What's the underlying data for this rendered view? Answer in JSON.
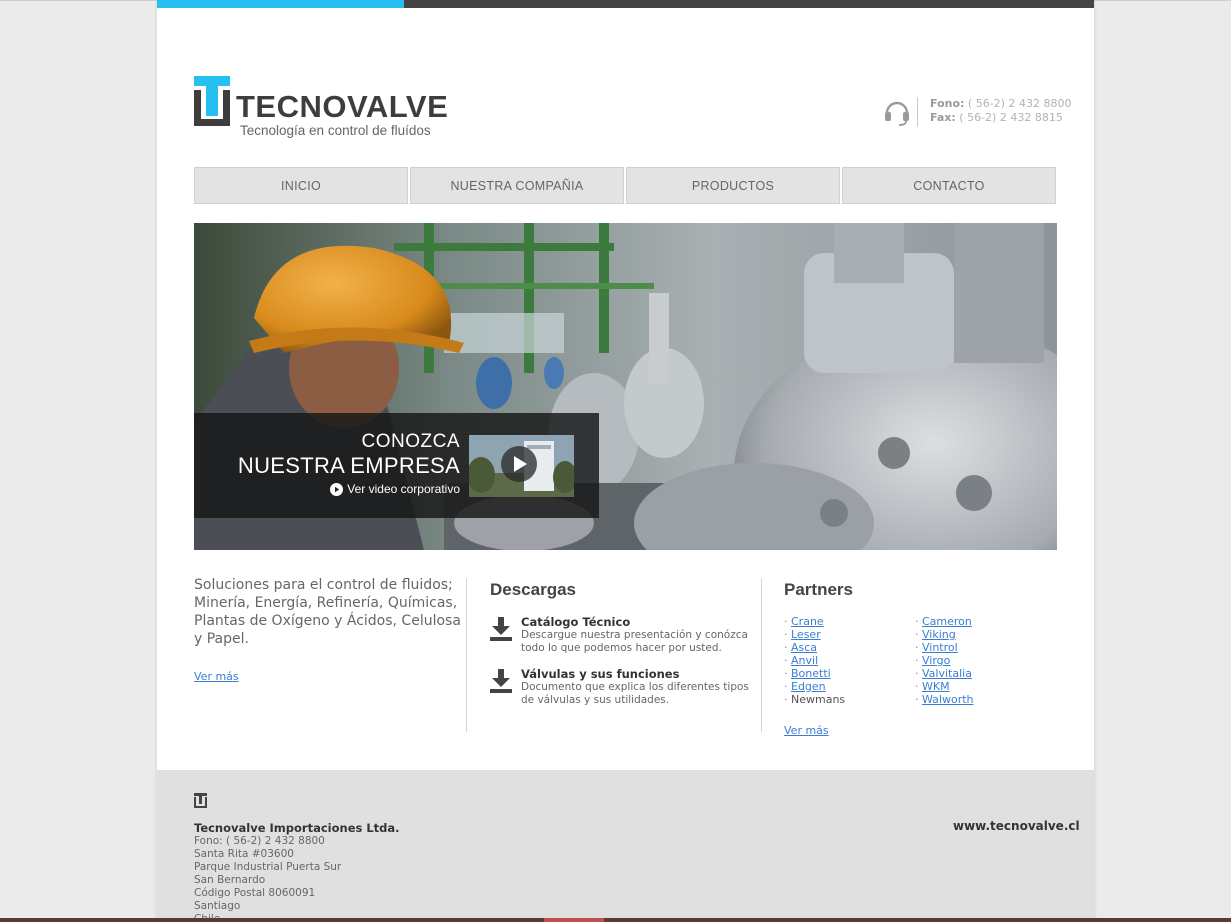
{
  "brand": {
    "name": "TECNOVALVE",
    "tagline": "Tecnología en control de fluídos",
    "accent_color": "#26c0f0",
    "dark_color": "#3d3d3d"
  },
  "contact": {
    "phone_label": "Fono:",
    "phone": " ( 56-2) 2 432 8800",
    "fax_label": "Fax:",
    "fax": " ( 56-2) 2 432 8815"
  },
  "nav": {
    "items": [
      {
        "label": "INICIO"
      },
      {
        "label": "NUESTRA COMPAÑIA"
      },
      {
        "label": "PRODUCTOS"
      },
      {
        "label": "CONTACTO"
      }
    ]
  },
  "hero": {
    "line1": "CONOZCA",
    "line2": "NUESTRA EMPRESA",
    "video_link": "Ver video corporativo"
  },
  "intro": {
    "text": "Soluciones para el control de fluidos; Minería, Energía, Refinería, Químicas, Plantas de Oxígeno y Ácidos, Celulosa y Papel.",
    "more": "Ver más"
  },
  "downloads": {
    "title": "Descargas",
    "items": [
      {
        "title": "Catálogo Técnico",
        "desc": "Descargue nuestra presentación y conózca todo lo que podemos hacer por usted."
      },
      {
        "title": "Válvulas y sus funciones",
        "desc": "Documento que explica los diferentes tipos de válvulas y sus utilidades."
      }
    ]
  },
  "partners": {
    "title": "Partners",
    "col1": [
      "Crane",
      "Leser",
      "Asca",
      "Anvil",
      "Bonetti",
      "Edgen",
      "Newmans"
    ],
    "col2": [
      "Cameron",
      "Viking",
      "Vintrol",
      "Virgo",
      "Valvitalia",
      "WKM",
      "Walworth"
    ],
    "more": "Ver más"
  },
  "footer": {
    "company": "Tecnovalve Importaciones Ltda.",
    "lines": [
      "Fono: ( 56-2) 2 432 8800",
      "Santa Rita #03600",
      "Parque Industrial Puerta Sur",
      "San Bernardo",
      "Código Postal 8060091",
      "Santiago",
      "Chile"
    ],
    "website": "www.tecnovalve.cl"
  }
}
